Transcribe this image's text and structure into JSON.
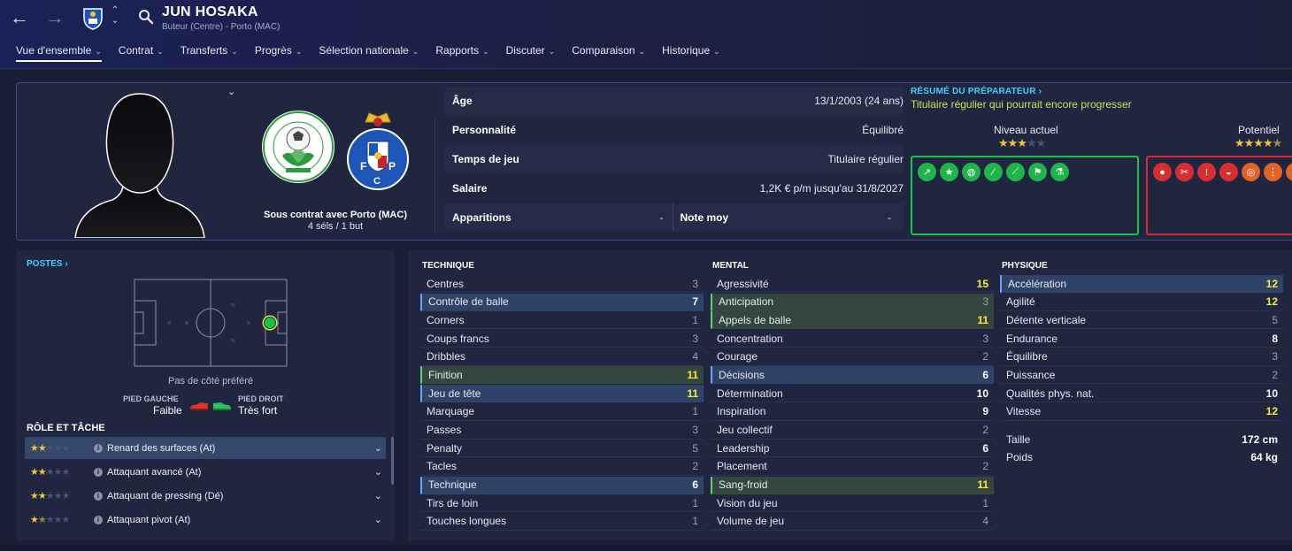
{
  "header": {
    "player_name": "JUN HOSAKA",
    "player_sub": "Buteur (Centre) - Porto (MAC)",
    "tabs": [
      {
        "label": "Vue d'ensemble"
      },
      {
        "label": "Contrat"
      },
      {
        "label": "Transferts"
      },
      {
        "label": "Progrès"
      },
      {
        "label": "Sélection nationale"
      },
      {
        "label": "Rapports"
      },
      {
        "label": "Discuter"
      },
      {
        "label": "Comparaison"
      },
      {
        "label": "Historique"
      }
    ],
    "icons": [
      "back-arrow-icon",
      "forward-arrow-icon",
      "club-crest-icon",
      "up-down-icon",
      "search-icon"
    ]
  },
  "profile": {
    "contract_title": "Sous contrat avec Porto (MAC)",
    "contract_sub": "4 séls / 1 but",
    "info": {
      "age_label": "Âge",
      "age_value": "13/1/2003 (24 ans)",
      "personality_label": "Personnalité",
      "personality_value": "Équilibré",
      "playtime_label": "Temps de jeu",
      "playtime_value": "Titulaire régulier",
      "salary_label": "Salaire",
      "salary_value": "1,2K € p/m jusqu'au 31/8/2027",
      "apps_label": "Apparitions",
      "apps_value": "-",
      "rating_label": "Note moy",
      "rating_value": "-"
    }
  },
  "coach": {
    "title": "RÉSUMÉ DU PRÉPARATEUR ›",
    "summary": "Titulaire régulier qui pourrait encore progresser",
    "current_label": "Niveau actuel",
    "current_stars": 3,
    "potential_label": "Potentiel",
    "potential_stars": 4.5,
    "strength_icons": [
      "trend-up-icon",
      "star-icon",
      "brain-icon",
      "boot-icon",
      "boot-icon",
      "flag-icon",
      "flask-icon"
    ],
    "weakness_icons": [
      "ball-icon",
      "foot-icon",
      "whistle-icon",
      "drop-icon",
      "target-icon",
      "footprint-icon",
      "boot-icon"
    ]
  },
  "positions": {
    "title": "POSTES ›",
    "pref_side": "Pas de côté préféré",
    "left_foot_label": "PIED GAUCHE",
    "left_foot_value": "Faible",
    "right_foot_label": "PIED DROIT",
    "right_foot_value": "Très fort",
    "colors": {
      "left_boot": "#d8342c",
      "right_boot": "#2bc15a",
      "position_dot": "#19c04a"
    }
  },
  "roles": {
    "title": "RÔLE ET TÂCHE",
    "items": [
      {
        "name": "Renard des surfaces (At)",
        "stars": 2
      },
      {
        "name": "Attaquant avancé (At)",
        "stars": 2
      },
      {
        "name": "Attaquant de pressing (Dé)",
        "stars": 2
      },
      {
        "name": "Attaquant pivot (At)",
        "stars": 1.5
      }
    ]
  },
  "attributes": {
    "technique": {
      "title": "TECHNIQUE",
      "rows": [
        {
          "name": "Centres",
          "value": "3",
          "hl": "",
          "color": "grey"
        },
        {
          "name": "Contrôle de balle",
          "value": "7",
          "hl": "blue",
          "color": "white"
        },
        {
          "name": "Corners",
          "value": "1",
          "hl": "",
          "color": "grey"
        },
        {
          "name": "Coups francs",
          "value": "3",
          "hl": "",
          "color": "grey"
        },
        {
          "name": "Dribbles",
          "value": "4",
          "hl": "",
          "color": "grey"
        },
        {
          "name": "Finition",
          "value": "11",
          "hl": "green",
          "color": "yellow"
        },
        {
          "name": "Jeu de tête",
          "value": "11",
          "hl": "blue",
          "color": "yellow"
        },
        {
          "name": "Marquage",
          "value": "1",
          "hl": "",
          "color": "grey"
        },
        {
          "name": "Passes",
          "value": "3",
          "hl": "",
          "color": "grey"
        },
        {
          "name": "Penalty",
          "value": "5",
          "hl": "",
          "color": "grey"
        },
        {
          "name": "Tacles",
          "value": "2",
          "hl": "",
          "color": "grey"
        },
        {
          "name": "Technique",
          "value": "6",
          "hl": "blue",
          "color": "white"
        },
        {
          "name": "Tirs de loin",
          "value": "1",
          "hl": "",
          "color": "grey"
        },
        {
          "name": "Touches longues",
          "value": "1",
          "hl": "",
          "color": "grey"
        }
      ]
    },
    "mental": {
      "title": "MENTAL",
      "rows": [
        {
          "name": "Agressivité",
          "value": "15",
          "hl": "",
          "color": "yellow"
        },
        {
          "name": "Anticipation",
          "value": "3",
          "hl": "green",
          "color": "grey"
        },
        {
          "name": "Appels de balle",
          "value": "11",
          "hl": "green",
          "color": "yellow"
        },
        {
          "name": "Concentration",
          "value": "3",
          "hl": "",
          "color": "grey"
        },
        {
          "name": "Courage",
          "value": "2",
          "hl": "",
          "color": "grey"
        },
        {
          "name": "Décisions",
          "value": "6",
          "hl": "blue",
          "color": "white"
        },
        {
          "name": "Détermination",
          "value": "10",
          "hl": "",
          "color": "white"
        },
        {
          "name": "Inspiration",
          "value": "9",
          "hl": "",
          "color": "white"
        },
        {
          "name": "Jeu collectif",
          "value": "2",
          "hl": "",
          "color": "grey"
        },
        {
          "name": "Leadership",
          "value": "6",
          "hl": "",
          "color": "white"
        },
        {
          "name": "Placement",
          "value": "2",
          "hl": "",
          "color": "grey"
        },
        {
          "name": "Sang-froid",
          "value": "11",
          "hl": "green",
          "color": "yellow"
        },
        {
          "name": "Vision du jeu",
          "value": "1",
          "hl": "",
          "color": "grey"
        },
        {
          "name": "Volume de jeu",
          "value": "4",
          "hl": "",
          "color": "grey"
        }
      ]
    },
    "physique": {
      "title": "PHYSIQUE",
      "rows": [
        {
          "name": "Accélération",
          "value": "12",
          "hl": "blue",
          "color": "yellow"
        },
        {
          "name": "Agilité",
          "value": "12",
          "hl": "",
          "color": "yellow"
        },
        {
          "name": "Détente verticale",
          "value": "5",
          "hl": "",
          "color": "grey"
        },
        {
          "name": "Endurance",
          "value": "8",
          "hl": "",
          "color": "white"
        },
        {
          "name": "Équilibre",
          "value": "3",
          "hl": "",
          "color": "grey"
        },
        {
          "name": "Puissance",
          "value": "2",
          "hl": "",
          "color": "grey"
        },
        {
          "name": "Qualités phys. nat.",
          "value": "10",
          "hl": "",
          "color": "white"
        },
        {
          "name": "Vitesse",
          "value": "12",
          "hl": "",
          "color": "yellow"
        }
      ],
      "height_label": "Taille",
      "height_value": "172 cm",
      "weight_label": "Poids",
      "weight_value": "64 kg"
    }
  }
}
